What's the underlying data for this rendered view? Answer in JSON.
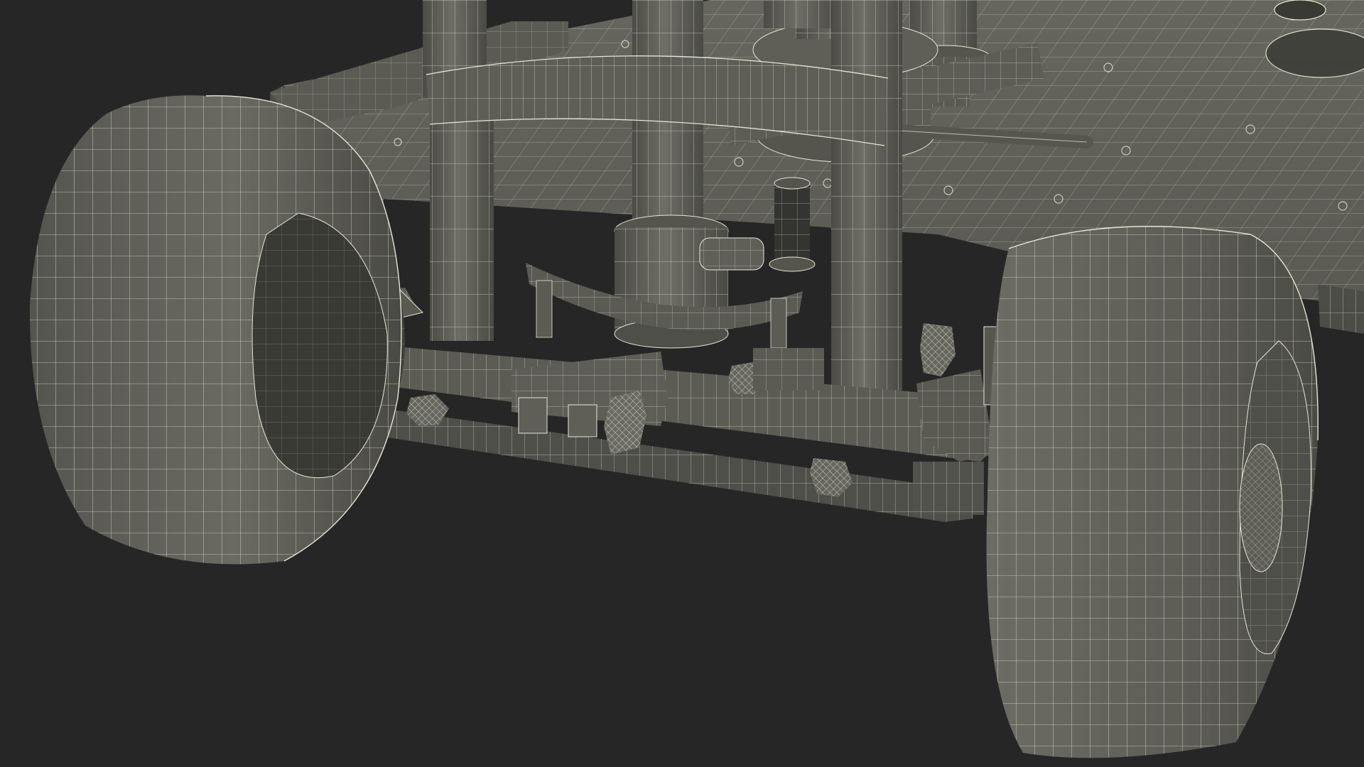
{
  "scene": {
    "subject": "camera-dolly-wireframe-render",
    "background_color": "#262626",
    "surface_color": "#5f5f58",
    "surface_dark": "#4e4e48",
    "surface_light": "#6f6f67",
    "wire_color": "#e8e6d2",
    "shadow_color": "#3f3f3a"
  }
}
